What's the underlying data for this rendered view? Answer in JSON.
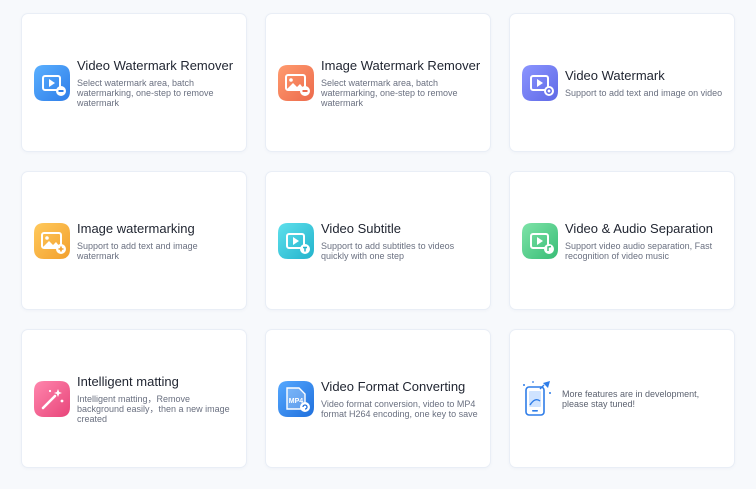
{
  "cards": [
    {
      "title": "Video Watermark Remover",
      "desc": "Select watermark area, batch watermarking, one-step to remove watermark",
      "icon": "video-watermark-remover-icon",
      "color": "#3d8ef5"
    },
    {
      "title": "Image Watermark Remover",
      "desc": "Select watermark area, batch watermarking, one-step to remove watermark",
      "icon": "image-watermark-remover-icon",
      "color": "#f2805a"
    },
    {
      "title": "Video Watermark",
      "desc": "Support to add text and image on video",
      "icon": "video-watermark-icon",
      "color": "#6e7df2"
    },
    {
      "title": "Image watermarking",
      "desc": "Support to add text and image watermark",
      "icon": "image-watermarking-icon",
      "color": "#f6b13c"
    },
    {
      "title": "Video Subtitle",
      "desc": "Support to add subtitles to videos quickly with one step",
      "icon": "video-subtitle-icon",
      "color": "#36c6d8"
    },
    {
      "title": "Video & Audio Separation",
      "desc": "Support video audio separation, Fast recognition of video music",
      "icon": "video-audio-separation-icon",
      "color": "#4fcf8c"
    },
    {
      "title": "Intelligent matting",
      "desc": "Intelligent matting，Remove background easily，then a new image created",
      "icon": "intelligent-matting-icon",
      "color": "#f05a8c"
    },
    {
      "title": "Video Format Converting",
      "desc": "Video format conversion, video to MP4 format H264 encoding, one key to save",
      "icon": "video-format-converting-icon",
      "color": "#2f86ec",
      "badge": "MP4"
    }
  ],
  "dev_card": {
    "text": "More features are in development, please stay tuned!",
    "icon": "phone-rocket-icon"
  }
}
